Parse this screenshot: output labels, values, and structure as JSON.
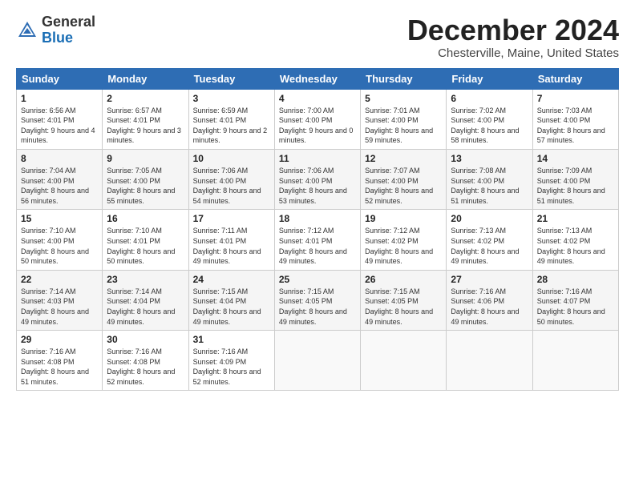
{
  "logo": {
    "general": "General",
    "blue": "Blue"
  },
  "header": {
    "title": "December 2024",
    "location": "Chesterville, Maine, United States"
  },
  "weekdays": [
    "Sunday",
    "Monday",
    "Tuesday",
    "Wednesday",
    "Thursday",
    "Friday",
    "Saturday"
  ],
  "weeks": [
    [
      {
        "day": "1",
        "sunrise": "6:56 AM",
        "sunset": "4:01 PM",
        "daylight": "9 hours and 4 minutes."
      },
      {
        "day": "2",
        "sunrise": "6:57 AM",
        "sunset": "4:01 PM",
        "daylight": "9 hours and 3 minutes."
      },
      {
        "day": "3",
        "sunrise": "6:59 AM",
        "sunset": "4:01 PM",
        "daylight": "9 hours and 2 minutes."
      },
      {
        "day": "4",
        "sunrise": "7:00 AM",
        "sunset": "4:00 PM",
        "daylight": "9 hours and 0 minutes."
      },
      {
        "day": "5",
        "sunrise": "7:01 AM",
        "sunset": "4:00 PM",
        "daylight": "8 hours and 59 minutes."
      },
      {
        "day": "6",
        "sunrise": "7:02 AM",
        "sunset": "4:00 PM",
        "daylight": "8 hours and 58 minutes."
      },
      {
        "day": "7",
        "sunrise": "7:03 AM",
        "sunset": "4:00 PM",
        "daylight": "8 hours and 57 minutes."
      }
    ],
    [
      {
        "day": "8",
        "sunrise": "7:04 AM",
        "sunset": "4:00 PM",
        "daylight": "8 hours and 56 minutes."
      },
      {
        "day": "9",
        "sunrise": "7:05 AM",
        "sunset": "4:00 PM",
        "daylight": "8 hours and 55 minutes."
      },
      {
        "day": "10",
        "sunrise": "7:06 AM",
        "sunset": "4:00 PM",
        "daylight": "8 hours and 54 minutes."
      },
      {
        "day": "11",
        "sunrise": "7:06 AM",
        "sunset": "4:00 PM",
        "daylight": "8 hours and 53 minutes."
      },
      {
        "day": "12",
        "sunrise": "7:07 AM",
        "sunset": "4:00 PM",
        "daylight": "8 hours and 52 minutes."
      },
      {
        "day": "13",
        "sunrise": "7:08 AM",
        "sunset": "4:00 PM",
        "daylight": "8 hours and 51 minutes."
      },
      {
        "day": "14",
        "sunrise": "7:09 AM",
        "sunset": "4:00 PM",
        "daylight": "8 hours and 51 minutes."
      }
    ],
    [
      {
        "day": "15",
        "sunrise": "7:10 AM",
        "sunset": "4:00 PM",
        "daylight": "8 hours and 50 minutes."
      },
      {
        "day": "16",
        "sunrise": "7:10 AM",
        "sunset": "4:01 PM",
        "daylight": "8 hours and 50 minutes."
      },
      {
        "day": "17",
        "sunrise": "7:11 AM",
        "sunset": "4:01 PM",
        "daylight": "8 hours and 49 minutes."
      },
      {
        "day": "18",
        "sunrise": "7:12 AM",
        "sunset": "4:01 PM",
        "daylight": "8 hours and 49 minutes."
      },
      {
        "day": "19",
        "sunrise": "7:12 AM",
        "sunset": "4:02 PM",
        "daylight": "8 hours and 49 minutes."
      },
      {
        "day": "20",
        "sunrise": "7:13 AM",
        "sunset": "4:02 PM",
        "daylight": "8 hours and 49 minutes."
      },
      {
        "day": "21",
        "sunrise": "7:13 AM",
        "sunset": "4:02 PM",
        "daylight": "8 hours and 49 minutes."
      }
    ],
    [
      {
        "day": "22",
        "sunrise": "7:14 AM",
        "sunset": "4:03 PM",
        "daylight": "8 hours and 49 minutes."
      },
      {
        "day": "23",
        "sunrise": "7:14 AM",
        "sunset": "4:04 PM",
        "daylight": "8 hours and 49 minutes."
      },
      {
        "day": "24",
        "sunrise": "7:15 AM",
        "sunset": "4:04 PM",
        "daylight": "8 hours and 49 minutes."
      },
      {
        "day": "25",
        "sunrise": "7:15 AM",
        "sunset": "4:05 PM",
        "daylight": "8 hours and 49 minutes."
      },
      {
        "day": "26",
        "sunrise": "7:15 AM",
        "sunset": "4:05 PM",
        "daylight": "8 hours and 49 minutes."
      },
      {
        "day": "27",
        "sunrise": "7:16 AM",
        "sunset": "4:06 PM",
        "daylight": "8 hours and 49 minutes."
      },
      {
        "day": "28",
        "sunrise": "7:16 AM",
        "sunset": "4:07 PM",
        "daylight": "8 hours and 50 minutes."
      }
    ],
    [
      {
        "day": "29",
        "sunrise": "7:16 AM",
        "sunset": "4:08 PM",
        "daylight": "8 hours and 51 minutes."
      },
      {
        "day": "30",
        "sunrise": "7:16 AM",
        "sunset": "4:08 PM",
        "daylight": "8 hours and 52 minutes."
      },
      {
        "day": "31",
        "sunrise": "7:16 AM",
        "sunset": "4:09 PM",
        "daylight": "8 hours and 52 minutes."
      },
      null,
      null,
      null,
      null
    ]
  ]
}
